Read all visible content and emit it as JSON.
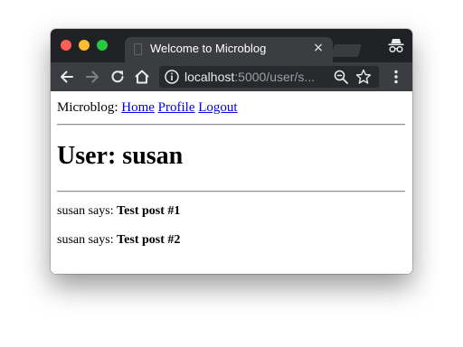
{
  "browser": {
    "tab": {
      "title": "Welcome to Microblog",
      "close_glyph": "×",
      "favicon": "page-icon"
    },
    "toolbar": {
      "back": "back-arrow-icon",
      "forward": "forward-arrow-icon",
      "reload": "reload-icon",
      "home": "home-icon",
      "url_host": "localhost",
      "url_path": ":5000/user/s...",
      "info": "info-icon",
      "zoom": "zoom-out-icon",
      "bookmark": "star-icon",
      "menu": "kebab-menu-icon"
    },
    "incognito": "incognito-icon",
    "colors": {
      "titlebar": "#202124",
      "toolbar": "#3c3d40",
      "urlbar": "#28292c",
      "close": "#ff5f57",
      "minimize": "#febc2e",
      "maximize": "#28c840",
      "link": "#0000ee"
    }
  },
  "page": {
    "nav": {
      "brand": "Microblog:",
      "links": [
        "Home",
        "Profile",
        "Logout"
      ]
    },
    "heading": "User: susan",
    "posts": [
      {
        "author_says": "susan says:",
        "body": "Test post #1"
      },
      {
        "author_says": "susan says:",
        "body": "Test post #2"
      }
    ]
  }
}
